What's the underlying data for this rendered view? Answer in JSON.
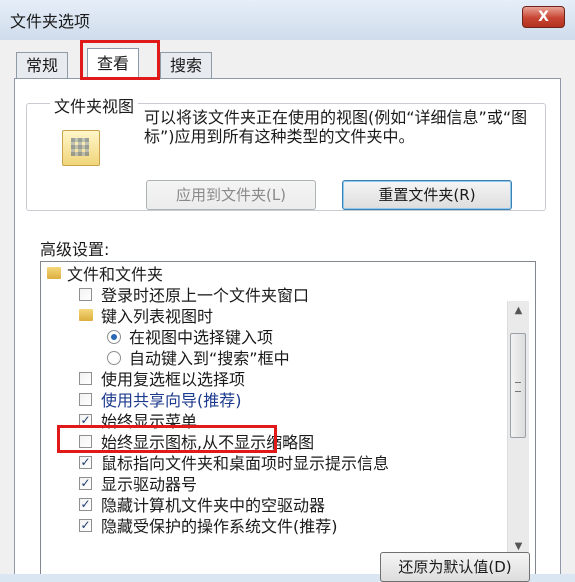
{
  "window": {
    "title": "文件夹选项",
    "close_label": "X"
  },
  "tabs": [
    {
      "label": "常规"
    },
    {
      "label": "查看",
      "active": true
    },
    {
      "label": "搜索"
    }
  ],
  "folder_views": {
    "title": "文件夹视图",
    "description": "可以将该文件夹正在使用的视图(例如“详细信息”或“图标”)应用到所有这种类型的文件夹中。",
    "apply_button": "应用到文件夹(L)",
    "reset_button": "重置文件夹(R)"
  },
  "advanced": {
    "label": "高级设置:",
    "items": [
      {
        "type": "folder",
        "label": "文件和文件夹",
        "level": 0
      },
      {
        "type": "checkbox",
        "label": "登录时还原上一个文件夹窗口",
        "checked": false,
        "level": 1
      },
      {
        "type": "folder",
        "label": "键入列表视图时",
        "level": 1
      },
      {
        "type": "radio",
        "label": "在视图中选择键入项",
        "checked": true,
        "level": 2
      },
      {
        "type": "radio",
        "label": "自动键入到“搜索”框中",
        "checked": false,
        "level": 2
      },
      {
        "type": "checkbox",
        "label": "使用复选框以选择项",
        "checked": false,
        "level": 1
      },
      {
        "type": "checkbox",
        "label": "使用共享向导(推荐)",
        "checked": false,
        "level": 1
      },
      {
        "type": "checkbox",
        "label": "始终显示菜单",
        "checked": true,
        "level": 1
      },
      {
        "type": "checkbox",
        "label": "始终显示图标,从不显示缩略图",
        "checked": false,
        "level": 1
      },
      {
        "type": "checkbox",
        "label": "鼠标指向文件夹和桌面项时显示提示信息",
        "checked": true,
        "level": 1
      },
      {
        "type": "checkbox",
        "label": "显示驱动器号",
        "checked": true,
        "level": 1
      },
      {
        "type": "checkbox",
        "label": "隐藏计算机文件夹中的空驱动器",
        "checked": true,
        "level": 1
      },
      {
        "type": "checkbox",
        "label": "隐藏受保护的操作系统文件(推荐)",
        "checked": true,
        "level": 1
      }
    ],
    "restore_button": "还原为默认值(D)"
  },
  "checkmark": "✓",
  "scroll_up": "▲",
  "scroll_down": "▼"
}
